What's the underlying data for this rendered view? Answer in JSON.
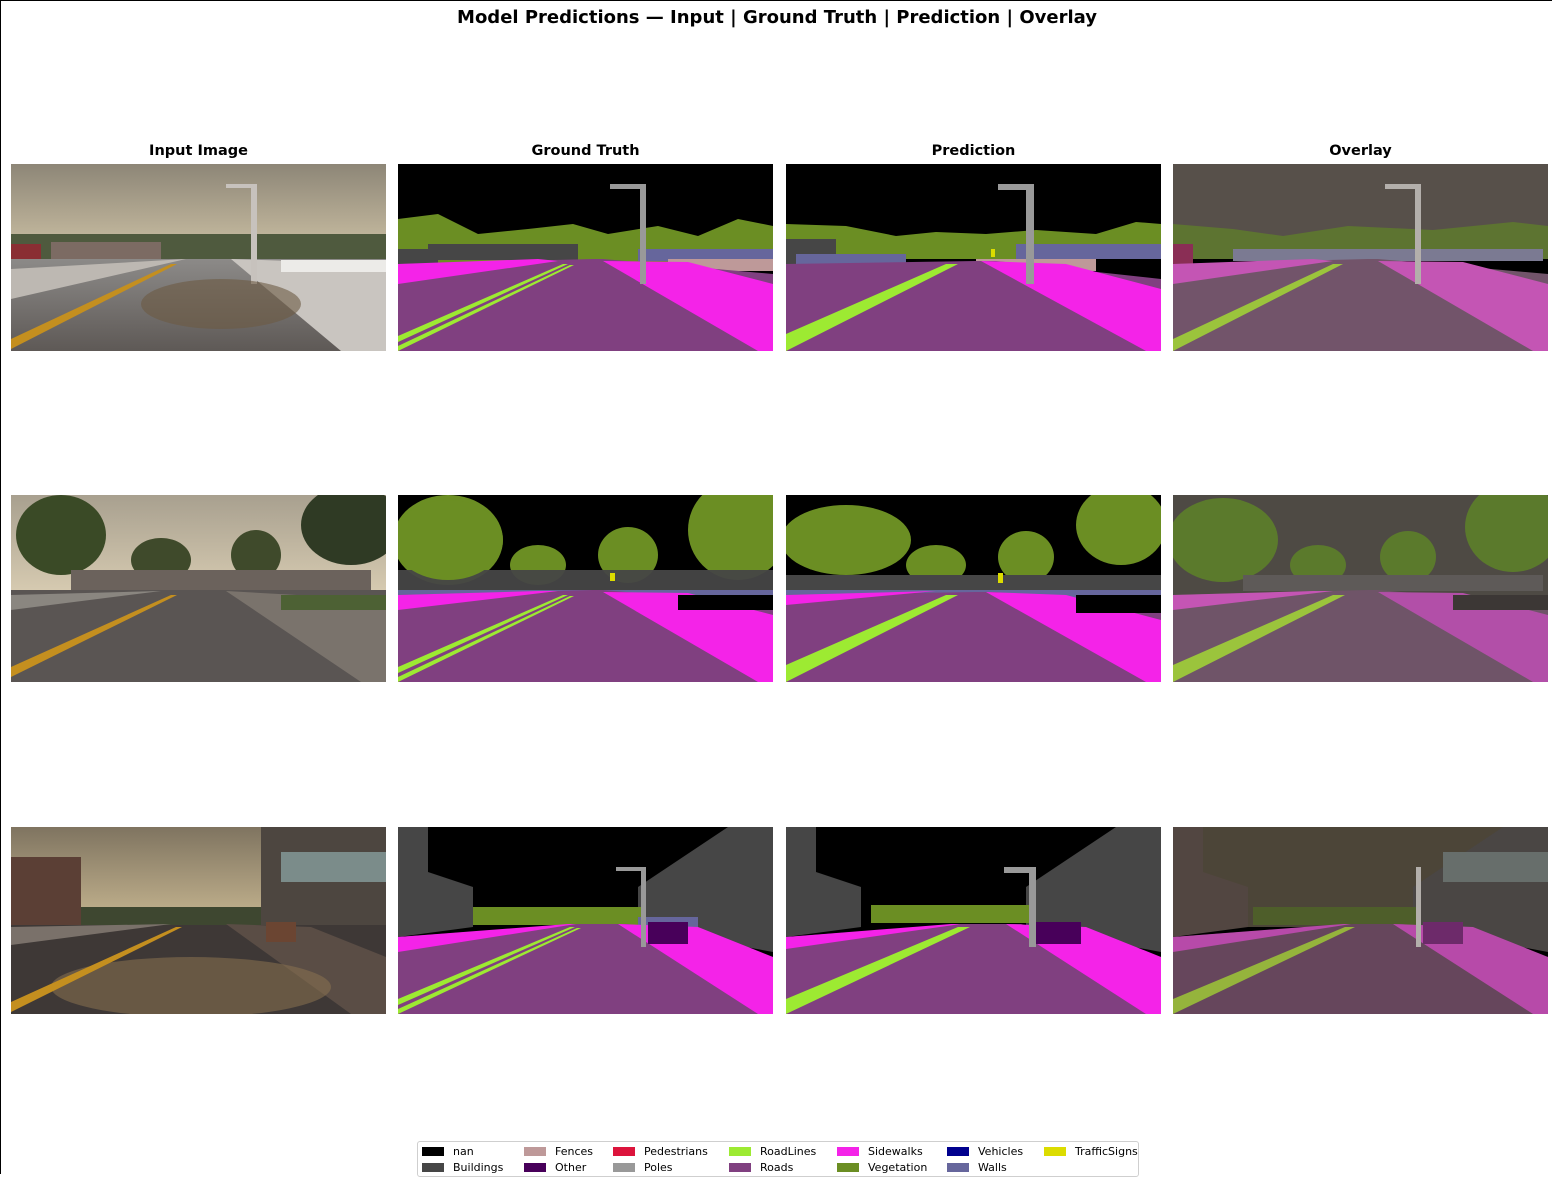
{
  "figure": {
    "title": "Model Predictions — Input | Ground Truth | Prediction | Overlay",
    "columns": [
      "Input Image",
      "Ground Truth",
      "Prediction",
      "Overlay"
    ]
  },
  "colors": {
    "nan": "#000000",
    "Buildings": "#464646",
    "Fences": "#be9999",
    "Other": "#48005a",
    "Pedestrians": "#dc143c",
    "Poles": "#999999",
    "RoadLines": "#9dea32",
    "Roads": "#804080",
    "Sidewalks": "#f423e8",
    "Vegetation": "#6b8e23",
    "Vehicles": "#00008e",
    "Walls": "#66669c",
    "TrafficSigns": "#dcdc00"
  },
  "legend": [
    {
      "label": "nan",
      "color": "#000000"
    },
    {
      "label": "Buildings",
      "color": "#464646"
    },
    {
      "label": "Fences",
      "color": "#be9999"
    },
    {
      "label": "Other",
      "color": "#48005a"
    },
    {
      "label": "Pedestrians",
      "color": "#dc143c"
    },
    {
      "label": "Poles",
      "color": "#999999"
    },
    {
      "label": "RoadLines",
      "color": "#9dea32"
    },
    {
      "label": "Roads",
      "color": "#804080"
    },
    {
      "label": "Sidewalks",
      "color": "#f423e8"
    },
    {
      "label": "Vegetation",
      "color": "#6b8e23"
    },
    {
      "label": "Vehicles",
      "color": "#00008e"
    },
    {
      "label": "Walls",
      "color": "#66669c"
    },
    {
      "label": "TrafficSigns",
      "color": "#dcdc00"
    }
  ]
}
